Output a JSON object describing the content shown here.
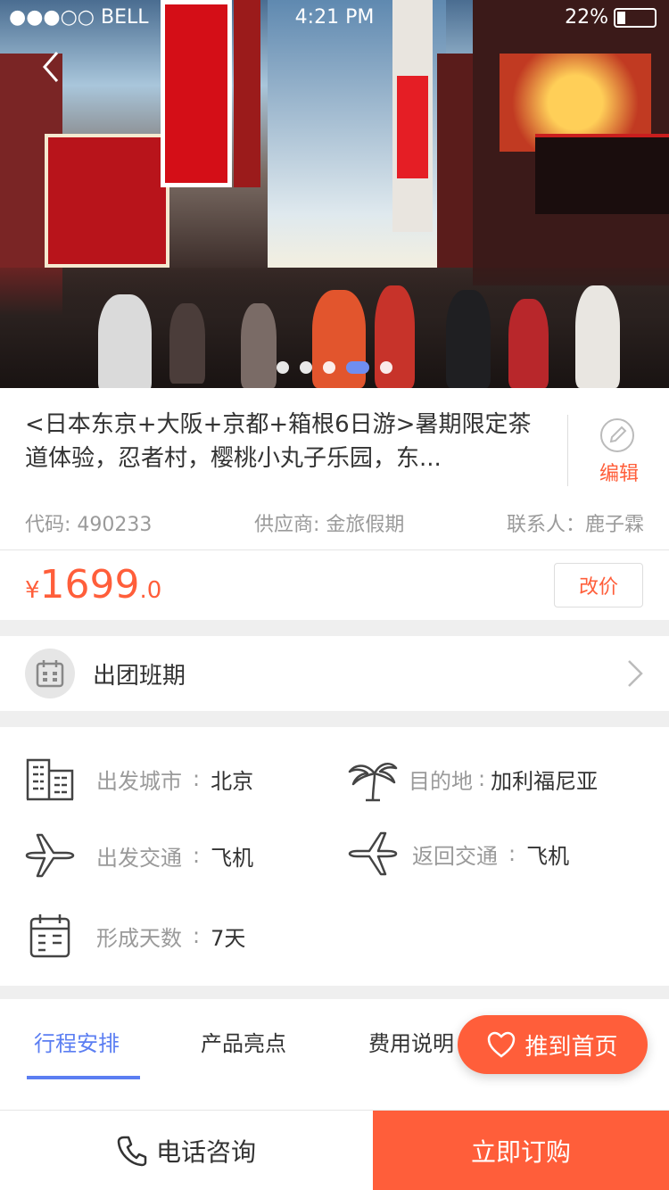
{
  "status_bar": {
    "carrier": "●●●○○ BELL",
    "time": "4:21 PM",
    "battery": "22%",
    "battery_level": 0.22
  },
  "carousel": {
    "slide_count": 5,
    "active_index": 3
  },
  "product": {
    "title": "<日本东京+大阪+京都+箱根6日游>暑期限定茶道体验，忍者村，樱桃小丸子乐园，东...",
    "edit_label": "编辑",
    "code_label": "代码: 490233",
    "supplier_label": "供应商: 金旅假期",
    "contact_label": "联系人：鹿子霖",
    "price_currency": "¥",
    "price_int": "1699",
    "price_dec": ".0",
    "change_price_label": "改价"
  },
  "schedule": {
    "label": "出团班期"
  },
  "info": {
    "departure_city": {
      "label": "出发城市",
      "value": "北京"
    },
    "destination": {
      "label": "目的地",
      "value": "加利福尼亚"
    },
    "departure_transport": {
      "label": "出发交通",
      "value": "飞机"
    },
    "return_transport": {
      "label": "返回交通",
      "value": "飞机"
    },
    "days": {
      "label": "形成天数",
      "value": "7天"
    },
    "separator": ":"
  },
  "tabs": [
    {
      "label": "行程安排"
    },
    {
      "label": "产品亮点"
    },
    {
      "label": "费用说明"
    }
  ],
  "promote_label": "推到首页",
  "bottom": {
    "call_label": "电话咨询",
    "buy_label": "立即订购"
  },
  "colors": {
    "accent": "#ff5e3a",
    "tab_active": "#5b7ef2"
  }
}
